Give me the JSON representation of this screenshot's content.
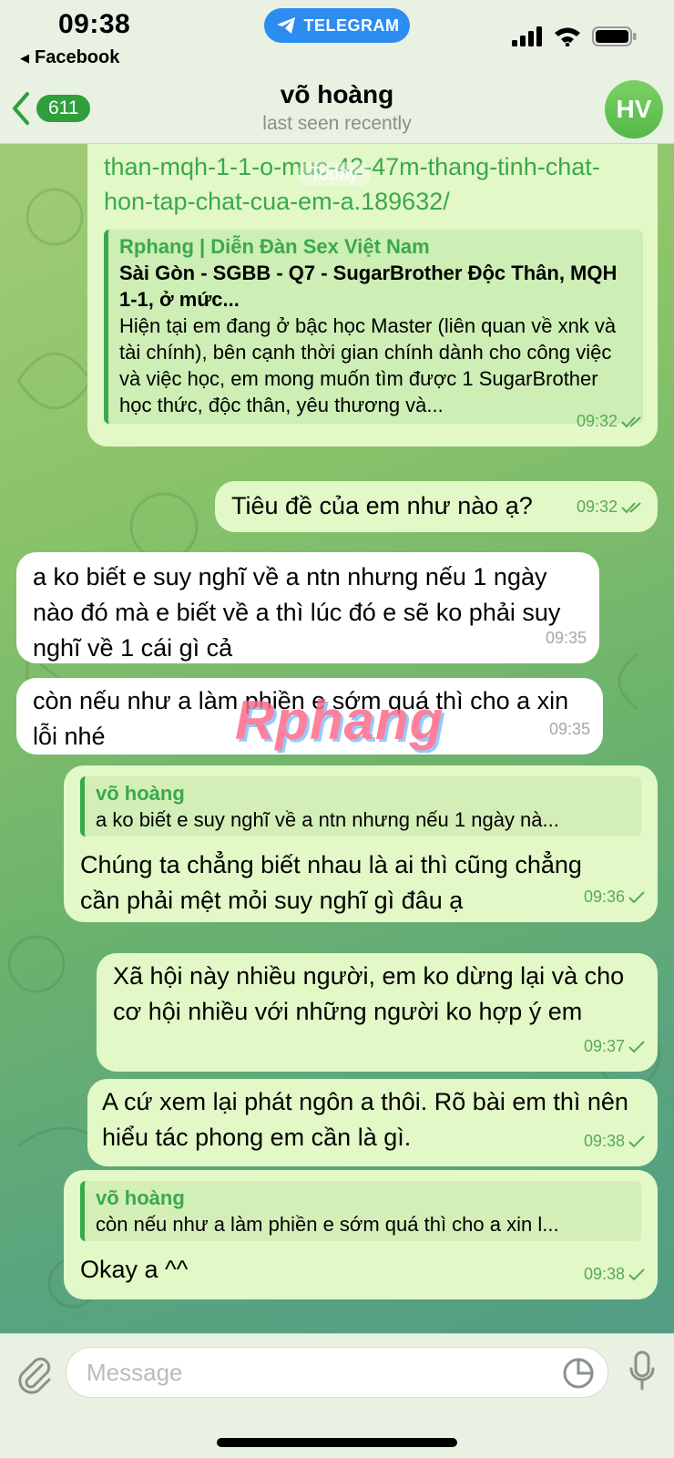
{
  "status": {
    "time": "09:38",
    "back_app": "Facebook",
    "pill": "TELEGRAM"
  },
  "header": {
    "back_count": "611",
    "name": "võ hoàng",
    "status": "last seen recently",
    "avatar_initials": "HV"
  },
  "date_badge": "Today",
  "watermark": "Rphang",
  "messages": [
    {
      "link": "than-mqh-1-1-o-muc-42-47m-thang-tinh-chat-hon-tap-chat-cua-em-a.189632/",
      "preview_site": "Rphang | Diễn Đàn Sex Việt Nam",
      "preview_title": "Sài Gòn - SGBB - Q7 - SugarBrother Độc Thân, MQH 1-1, ở mức...",
      "preview_desc": "Hiện tại em đang ở bậc học Master (liên quan về xnk và tài chính), bên cạnh thời gian chính dành cho công việc và việc học, em mong muốn tìm được 1 SugarBrother học thức, độc thân, yêu thương và...",
      "time": "09:32"
    },
    {
      "text": "Tiêu đề của em như nào ạ?",
      "time": "09:32"
    },
    {
      "text": "a ko biết e suy nghĩ về a ntn nhưng nếu 1 ngày nào đó mà e biết về a thì lúc đó e sẽ ko phải suy nghĩ về 1 cái gì cả",
      "time": "09:35"
    },
    {
      "text": "còn nếu như a làm phiền e sớm quá thì cho a xin lỗi nhé",
      "time": "09:35"
    },
    {
      "reply_name": "võ hoàng",
      "reply_text": "a ko biết e suy nghĩ về a ntn nhưng nếu 1 ngày nà...",
      "text": "Chúng ta chẳng biết nhau là ai thì cũng chẳng cần phải mệt mỏi suy nghĩ gì đâu ạ",
      "time": "09:36"
    },
    {
      "text": "Xã hội này nhiều người, em ko dừng lại và cho cơ hội nhiều với những người ko hợp ý em",
      "time": "09:37"
    },
    {
      "text": "A cứ xem lại phát ngôn a thôi. Rõ bài em thì nên hiểu tác phong em cần là gì.",
      "time": "09:38"
    },
    {
      "reply_name": "võ hoàng",
      "reply_text": "còn nếu như a làm phiền e sớm quá thì cho a xin l...",
      "text": "Okay a ^^",
      "time": "09:38"
    }
  ],
  "input": {
    "placeholder": "Message"
  },
  "icons": [
    "back-chevron-icon",
    "telegram-icon",
    "signal-icon",
    "wifi-icon",
    "battery-icon",
    "double-check-icon",
    "check-icon",
    "attach-icon",
    "sticker-icon",
    "mic-icon"
  ],
  "colors": {
    "accent_green": "#3aa94b",
    "outgoing_bubble": "#e2f8c7",
    "incoming_bubble": "#ffffff",
    "telegram_blue": "#2d8cf0"
  }
}
